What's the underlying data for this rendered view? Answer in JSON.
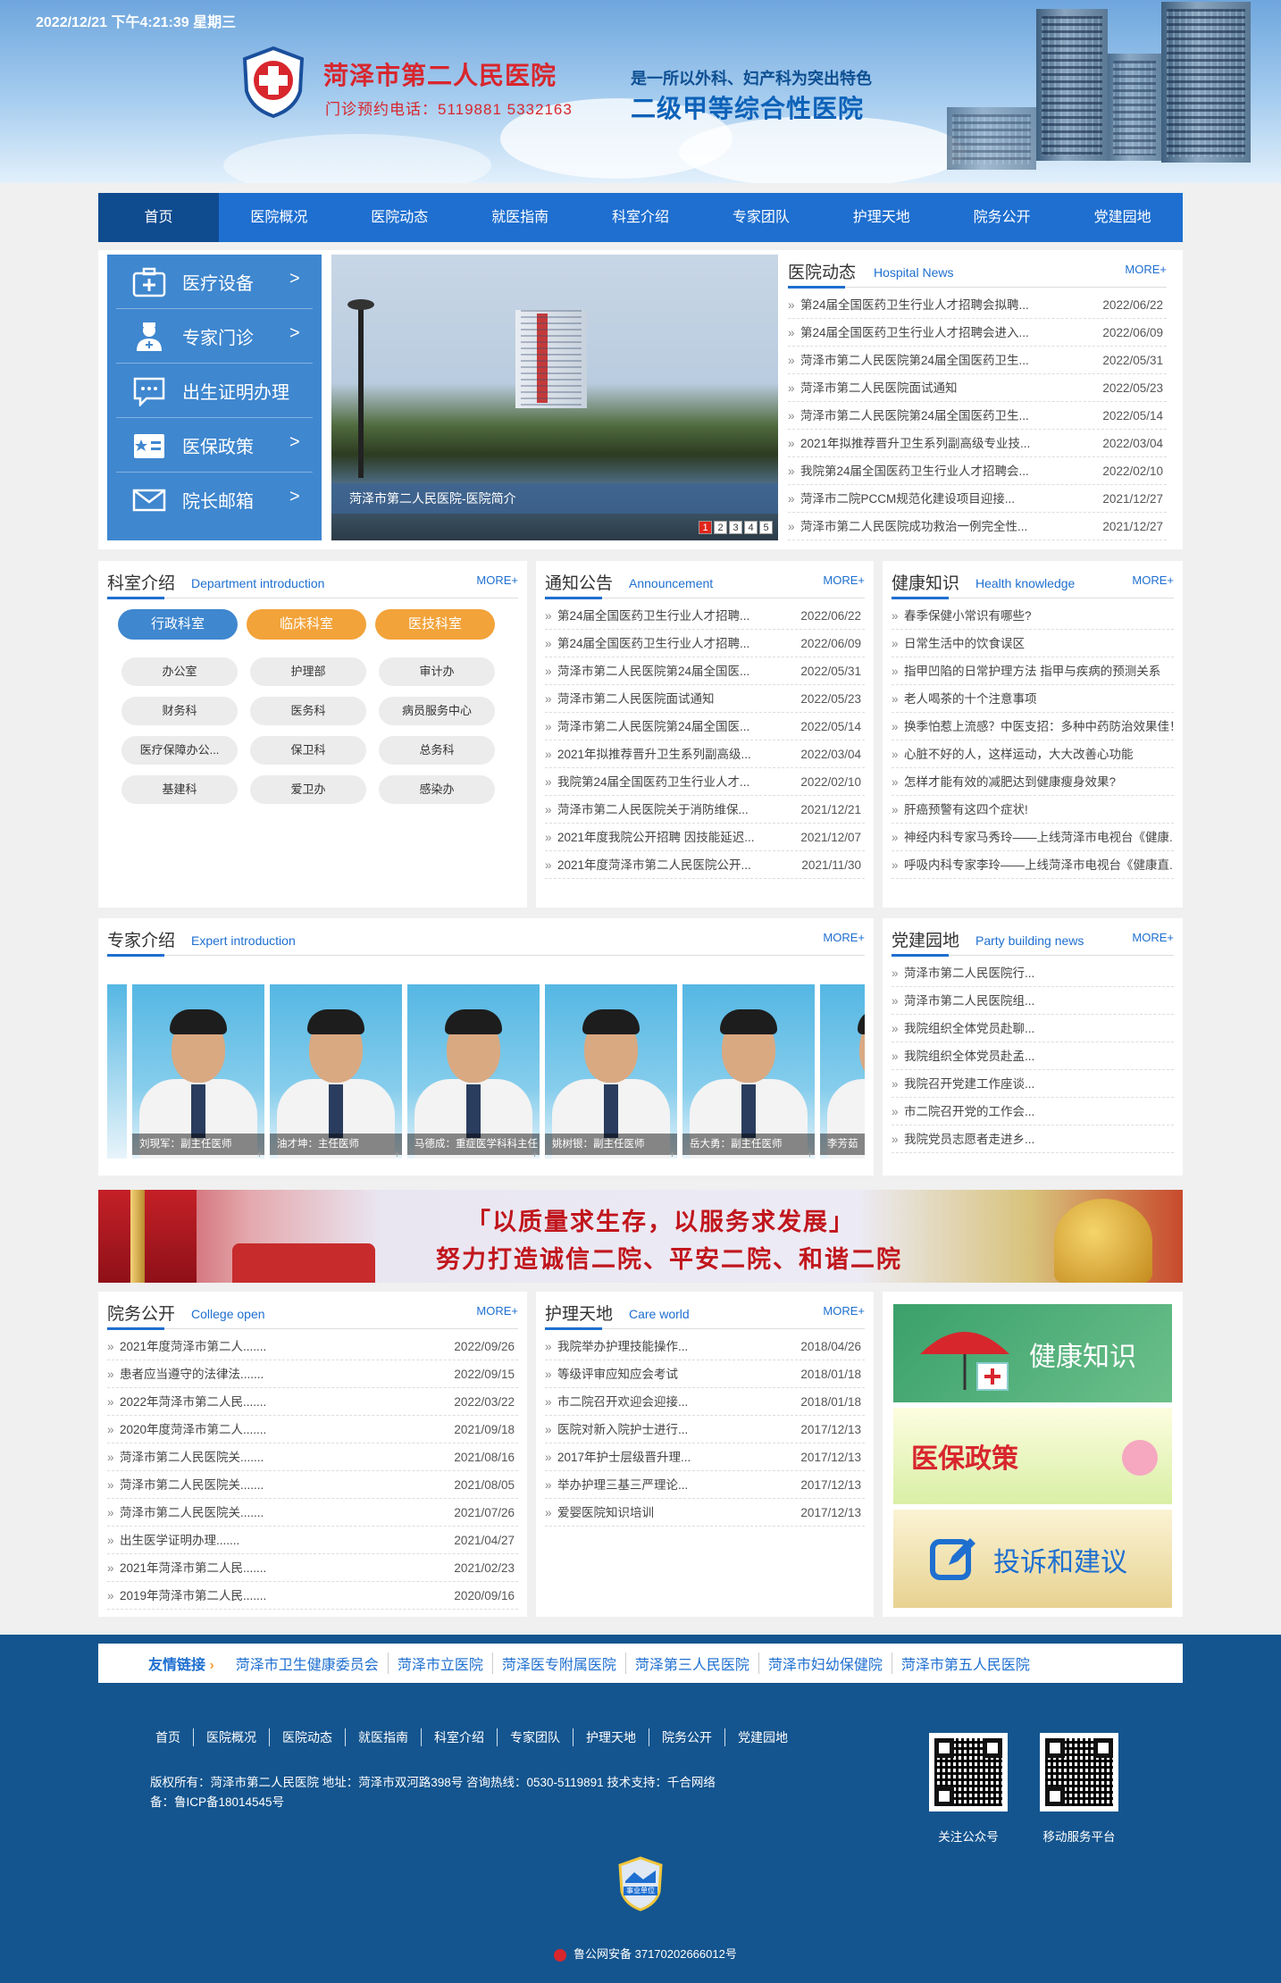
{
  "header": {
    "datetime": "2022/12/21 下午4:21:39 星期三",
    "hospital_name": "菏泽市第二人民医院",
    "phone": "门诊预约电话：5119881  5332163",
    "slogan1": "是一所以外科、妇产科为突出特色",
    "slogan2": "二级甲等综合性医院"
  },
  "nav": [
    "首页",
    "医院概况",
    "医院动态",
    "就医指南",
    "科室介绍",
    "专家团队",
    "护理天地",
    "院务公开",
    "党建园地"
  ],
  "quick": [
    {
      "label": "医疗设备",
      "arrow": ">",
      "icon": "medical-kit-icon"
    },
    {
      "label": "专家门诊",
      "arrow": ">",
      "icon": "doctor-icon"
    },
    {
      "label": "出生证明办理",
      "arrow": "",
      "icon": "chat-icon"
    },
    {
      "label": "医保政策",
      "arrow": ">",
      "icon": "medical-card-icon"
    },
    {
      "label": "院长邮箱",
      "arrow": ">",
      "icon": "envelope-icon"
    }
  ],
  "slide": {
    "caption": "菏泽市第二人民医院-医院简介",
    "pages": [
      "1",
      "2",
      "3",
      "4",
      "5"
    ],
    "active": "1"
  },
  "news": {
    "title": "医院动态",
    "en": "Hospital News",
    "more": "MORE+",
    "items": [
      {
        "t": "第24届全国医药卫生行业人才招聘会拟聘...",
        "d": "2022/06/22"
      },
      {
        "t": "第24届全国医药卫生行业人才招聘会进入...",
        "d": "2022/06/09"
      },
      {
        "t": "菏泽市第二人民医院第24届全国医药卫生...",
        "d": "2022/05/31"
      },
      {
        "t": "菏泽市第二人民医院面试通知",
        "d": "2022/05/23"
      },
      {
        "t": "菏泽市第二人民医院第24届全国医药卫生...",
        "d": "2022/05/14"
      },
      {
        "t": "2021年拟推荐晋升卫生系列副高级专业技...",
        "d": "2022/03/04"
      },
      {
        "t": "我院第24届全国医药卫生行业人才招聘会...",
        "d": "2022/02/10"
      },
      {
        "t": "菏泽市二院PCCM规范化建设项目迎接...",
        "d": "2021/12/27"
      },
      {
        "t": "菏泽市第二人民医院成功救治一例完全性...",
        "d": "2021/12/27"
      }
    ]
  },
  "dept": {
    "title": "科室介绍",
    "en": "Department introduction",
    "more": "MORE+",
    "tabs": [
      "行政科室",
      "临床科室",
      "医技科室"
    ],
    "items": [
      "办公室",
      "护理部",
      "审计办",
      "财务科",
      "医务科",
      "病员服务中心",
      "医疗保障办公...",
      "保卫科",
      "总务科",
      "基建科",
      "爱卫办",
      "感染办"
    ]
  },
  "notice": {
    "title": "通知公告",
    "en": "Announcement",
    "more": "MORE+",
    "items": [
      {
        "t": "第24届全国医药卫生行业人才招聘...",
        "d": "2022/06/22"
      },
      {
        "t": "第24届全国医药卫生行业人才招聘...",
        "d": "2022/06/09"
      },
      {
        "t": "菏泽市第二人民医院第24届全国医...",
        "d": "2022/05/31"
      },
      {
        "t": "菏泽市第二人民医院面试通知",
        "d": "2022/05/23"
      },
      {
        "t": "菏泽市第二人民医院第24届全国医...",
        "d": "2022/05/14"
      },
      {
        "t": "2021年拟推荐晋升卫生系列副高级...",
        "d": "2022/03/04"
      },
      {
        "t": "我院第24届全国医药卫生行业人才...",
        "d": "2022/02/10"
      },
      {
        "t": "菏泽市第二人民医院关于消防维保...",
        "d": "2021/12/21"
      },
      {
        "t": "2021年度我院公开招聘 因技能延迟...",
        "d": "2021/12/07"
      },
      {
        "t": "2021年度菏泽市第二人民医院公开...",
        "d": "2021/11/30"
      }
    ]
  },
  "health": {
    "title": "健康知识",
    "en": "Health knowledge",
    "more": "MORE+",
    "items": [
      "春季保健小常识有哪些?",
      "日常生活中的饮食误区",
      "指甲凹陷的日常护理方法 指甲与疾病的预测关系",
      "老人喝茶的十个注意事项",
      "换季怕惹上流感？中医支招：多种中药防治效果佳！",
      "心脏不好的人，这样运动，大大改善心功能",
      "怎样才能有效的减肥达到健康瘦身效果?",
      "肝癌预警有这四个症状!",
      "神经内科专家马秀玲——上线菏泽市电视台《健康...",
      "呼吸内科专家李玲——上线菏泽市电视台《健康直..."
    ]
  },
  "experts": {
    "title": "专家介绍",
    "en": "Expert introduction",
    "more": "MORE+",
    "items": [
      "刘現军：副主任医师",
      "油才坤：主任医师",
      "马德成：重症医学科科主任",
      "姚树银：副主任医师",
      "岳大勇：副主任医师",
      "李芳茹"
    ]
  },
  "party": {
    "title": "党建园地",
    "en": "Party building news",
    "more": "MORE+",
    "items": [
      "菏泽市第二人民医院行...",
      "菏泽市第二人民医院组...",
      "我院组织全体党员赴聊...",
      "我院组织全体党员赴孟...",
      "我院召开党建工作座谈...",
      "市二院召开党的工作会...",
      "我院党员志愿者走进乡..."
    ]
  },
  "banner": {
    "line1": "「以质量求生存，以服务求发展」",
    "line2": "努力打造诚信二院、平安二院、和谐二院"
  },
  "affairs": {
    "title": "院务公开",
    "en": "College open",
    "more": "MORE+",
    "items": [
      {
        "t": "2021年度菏泽市第二人.......",
        "d": "2022/09/26"
      },
      {
        "t": "患者应当遵守的法律法.......",
        "d": "2022/09/15"
      },
      {
        "t": "2022年菏泽市第二人民.......",
        "d": "2022/03/22"
      },
      {
        "t": "2020年度菏泽市第二人.......",
        "d": "2021/09/18"
      },
      {
        "t": "菏泽市第二人民医院关.......",
        "d": "2021/08/16"
      },
      {
        "t": "菏泽市第二人民医院关.......",
        "d": "2021/08/05"
      },
      {
        "t": "菏泽市第二人民医院关.......",
        "d": "2021/07/26"
      },
      {
        "t": "出生医学证明办理.......",
        "d": "2021/04/27"
      },
      {
        "t": "2021年菏泽市第二人民.......",
        "d": "2021/02/23"
      },
      {
        "t": "2019年菏泽市第二人民.......",
        "d": "2020/09/16"
      }
    ]
  },
  "nursing": {
    "title": "护理天地",
    "en": "Care world",
    "more": "MORE+",
    "items": [
      {
        "t": "我院举办护理技能操作...",
        "d": "2018/04/26"
      },
      {
        "t": "等级评审应知应会考试",
        "d": "2018/01/18"
      },
      {
        "t": "市二院召开欢迎会迎接...",
        "d": "2018/01/18"
      },
      {
        "t": "医院对新入院护士进行...",
        "d": "2017/12/13"
      },
      {
        "t": "2017年护士层级晋升理...",
        "d": "2017/12/13"
      },
      {
        "t": "举办护理三基三严理论...",
        "d": "2017/12/13"
      },
      {
        "t": "爱婴医院知识培训",
        "d": "2017/12/13"
      }
    ]
  },
  "ads": [
    "健康知识",
    "医保政策",
    "投诉和建议"
  ],
  "links": {
    "head": "友情链接",
    "items": [
      "菏泽市卫生健康委员会",
      "菏泽市立医院",
      "菏泽医专附属医院",
      "菏泽第三人民医院",
      "菏泽市妇幼保健院",
      "菏泽市第五人民医院"
    ]
  },
  "footer": {
    "nav": [
      "首页",
      "医院概况",
      "医院动态",
      "就医指南",
      "科室介绍",
      "专家团队",
      "护理天地",
      "院务公开",
      "党建园地"
    ],
    "line1": "版权所有：菏泽市第二人民医院     地址：菏泽市双河路398号    咨询热线：0530-5119891    技术支持：千合网络",
    "line2": "备：鲁ICP备18014545号",
    "qr1": "关注公众号",
    "qr2": "移动服务平台",
    "badge": "事业单位",
    "police": "鲁公网安备 37170202666012号"
  },
  "colors": {
    "brand_blue": "#1e6fd0",
    "nav_active": "#0f4b8f",
    "red": "#d8262d",
    "orange": "#f2a33a",
    "footer": "#14558f"
  }
}
